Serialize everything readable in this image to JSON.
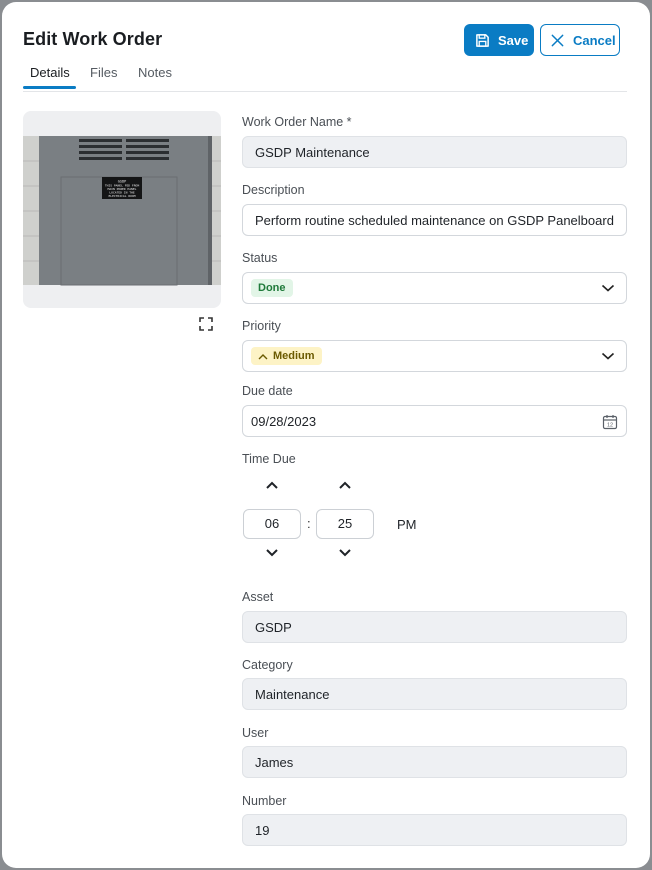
{
  "dialog": {
    "title": "Edit Work Order",
    "save_label": "Save",
    "cancel_label": "Cancel"
  },
  "tabs": [
    {
      "label": "Details",
      "active": true
    },
    {
      "label": "Files",
      "active": false
    },
    {
      "label": "Notes",
      "active": false
    }
  ],
  "photo": {
    "plate_text": [
      "GSDP",
      "THIS PANEL FED FROM",
      "MAIN POWER PANEL",
      "LOCATED IN THE",
      "ELECTRICAL ROOM"
    ]
  },
  "form": {
    "name": {
      "label": "Work Order Name *",
      "value": "GSDP Maintenance"
    },
    "description": {
      "label": "Description",
      "value": "Perform routine scheduled maintenance on GSDP Panelboard"
    },
    "status": {
      "label": "Status",
      "value": "Done"
    },
    "priority": {
      "label": "Priority",
      "value": "Medium"
    },
    "due_date": {
      "label": "Due date",
      "value": "09/28/2023"
    },
    "time_due": {
      "label": "Time Due",
      "hour": "06",
      "minute": "25",
      "separator": ":",
      "period": "PM"
    },
    "asset": {
      "label": "Asset",
      "value": "GSDP"
    },
    "category": {
      "label": "Category",
      "value": "Maintenance"
    },
    "user": {
      "label": "User",
      "value": "James"
    },
    "number": {
      "label": "Number",
      "value": "19"
    }
  },
  "colors": {
    "accent": "#0a7cc4",
    "done_badge_bg": "#e2f5e7",
    "done_badge_text": "#1f7a3a",
    "medium_badge_bg": "#fdf3c6",
    "medium_badge_text": "#6b5a00"
  },
  "icons": {
    "save": "floppy-disk-icon",
    "cancel": "close-icon",
    "expand": "expand-icon",
    "dropdown": "chevron-down-icon",
    "calendar": "calendar-icon",
    "increment": "chevron-up-icon",
    "decrement": "chevron-down-icon",
    "priority": "chevron-up-icon"
  }
}
